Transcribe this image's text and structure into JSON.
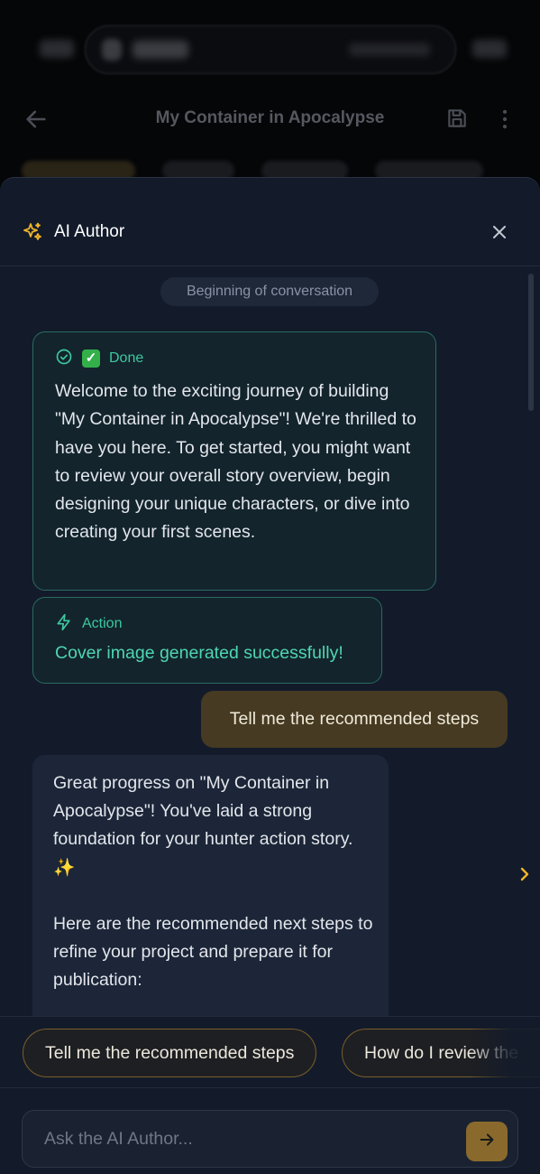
{
  "app": {
    "title": "My Container in Apocalypse"
  },
  "sheet": {
    "title": "AI Author",
    "conversation_start": "Beginning of conversation"
  },
  "messages": {
    "done_card": {
      "status_emoji": "✓",
      "status_label": "Done",
      "body": "Welcome to the exciting journey of building \"My Container in Apocalypse\"! We're thrilled to have you here. To get started, you might want to review your overall story overview, begin designing your unique characters, or dive into creating your first scenes."
    },
    "action_card": {
      "label": "Action",
      "body": "Cover image generated successfully!"
    },
    "user_message": "Tell me the recommended steps",
    "ai_message": "Great progress on \"My Container in Apocalypse\"! You've laid a strong foundation for your hunter action story. ✨\n\nHere are the recommended next steps to refine your project and prepare it for publication:"
  },
  "suggestions": [
    "Tell me the recommended steps",
    "How do I review the"
  ],
  "composer": {
    "placeholder": "Ask the AI Author..."
  },
  "colors": {
    "sheet_bg": "#131b2b",
    "accent_teal": "#3dc9a0",
    "accent_gold": "#f0b429",
    "user_bubble": "#463a22"
  }
}
